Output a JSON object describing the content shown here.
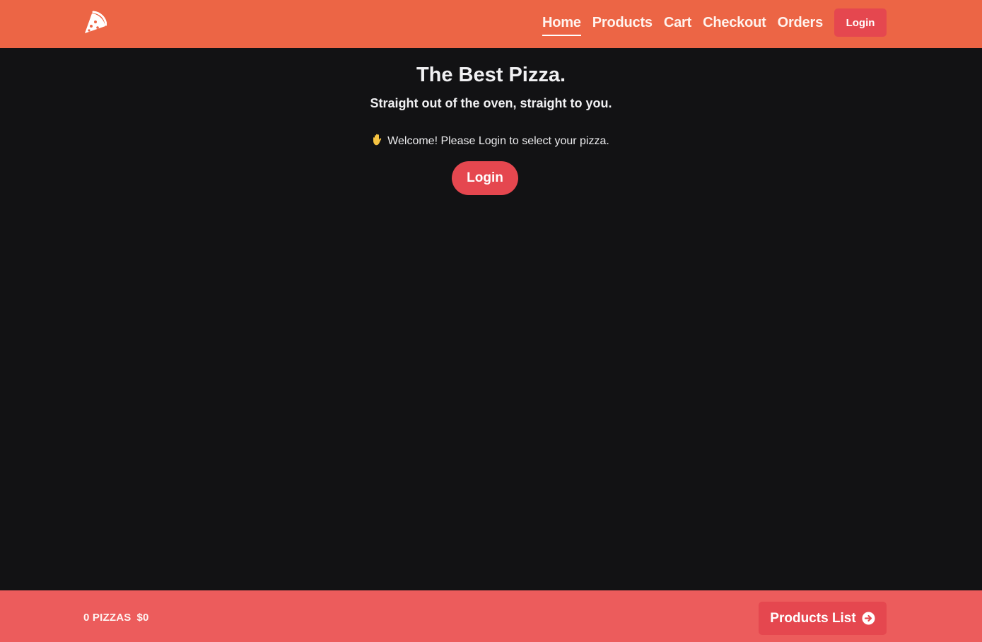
{
  "header": {
    "logo_icon": "pizza-slice-icon",
    "nav": [
      {
        "label": "Home",
        "active": true
      },
      {
        "label": "Products",
        "active": false
      },
      {
        "label": "Cart",
        "active": false
      },
      {
        "label": "Checkout",
        "active": false
      },
      {
        "label": "Orders",
        "active": false
      }
    ],
    "login_label": "Login"
  },
  "hero": {
    "title": "The Best Pizza.",
    "subtitle": "Straight out of the oven, straight to you.",
    "welcome_icon": "waving-hand-icon",
    "welcome_text": "Welcome! Please Login to select your pizza.",
    "login_label": "Login"
  },
  "footer": {
    "pizza_count": "0 PIZZAS",
    "total": "$0",
    "products_button_label": "Products List",
    "products_button_icon": "arrow-right-circle-icon"
  },
  "colors": {
    "header_bg": "#ec6545",
    "page_bg": "#121214",
    "accent": "#e5474f",
    "footer_bg": "#ec5c5c"
  }
}
